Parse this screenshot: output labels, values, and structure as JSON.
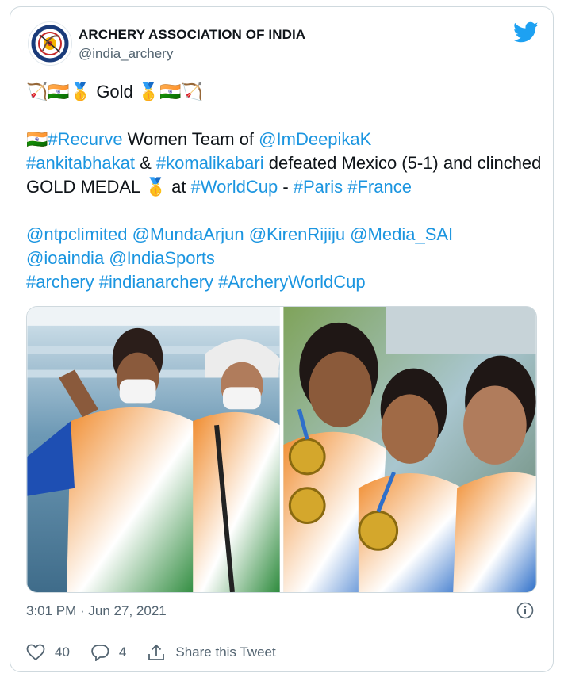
{
  "account": {
    "name": "ARCHERY ASSOCIATION OF INDIA",
    "handle": "@india_archery",
    "avatar_icon": "archery-association-logo"
  },
  "tweet": {
    "line1": {
      "emoji_prefix": "🏹🇮🇳🥇",
      "word": "Gold",
      "emoji_suffix": " 🥇🇮🇳🏹"
    },
    "para2": {
      "flag": "🇮🇳",
      "tag_recurve": "#Recurve",
      "t1": " Women Team of ",
      "mention_deepika": "@ImDeepikaK",
      "tag_ankita": "#ankitabhakat",
      "t2": " & ",
      "tag_komalika": "#komalikabari",
      "t3": " defeated Mexico (5-1) and clinched GOLD MEDAL ",
      "medal": "🥇",
      "t4": " at ",
      "tag_worldcup": "#WorldCup",
      "t5": " - ",
      "tag_paris": "#Paris",
      "tag_france": "#France"
    },
    "para3": {
      "mention_ntpc": "@ntpclimited",
      "mention_munda": "@MundaArjun",
      "mention_kiren": "@KirenRijiju",
      "mention_sai": "@Media_SAI",
      "mention_ioa": "@ioaindia",
      "mention_sports": "@IndiaSports",
      "tag_archery": "#archery",
      "tag_indianarchery": "#indianarchery",
      "tag_awc": "#ArcheryWorldCup"
    }
  },
  "media": {
    "photo_left": "two-archers-waving-photo",
    "photo_right": "three-archers-with-medals-photo"
  },
  "timestamp": "3:01 PM · Jun 27, 2021",
  "actions": {
    "likes": "40",
    "replies": "4",
    "share_label": "Share this Tweet"
  },
  "colors": {
    "link": "#1b95e0",
    "secondary_text": "#536471",
    "brand_blue": "#1da1f2"
  }
}
